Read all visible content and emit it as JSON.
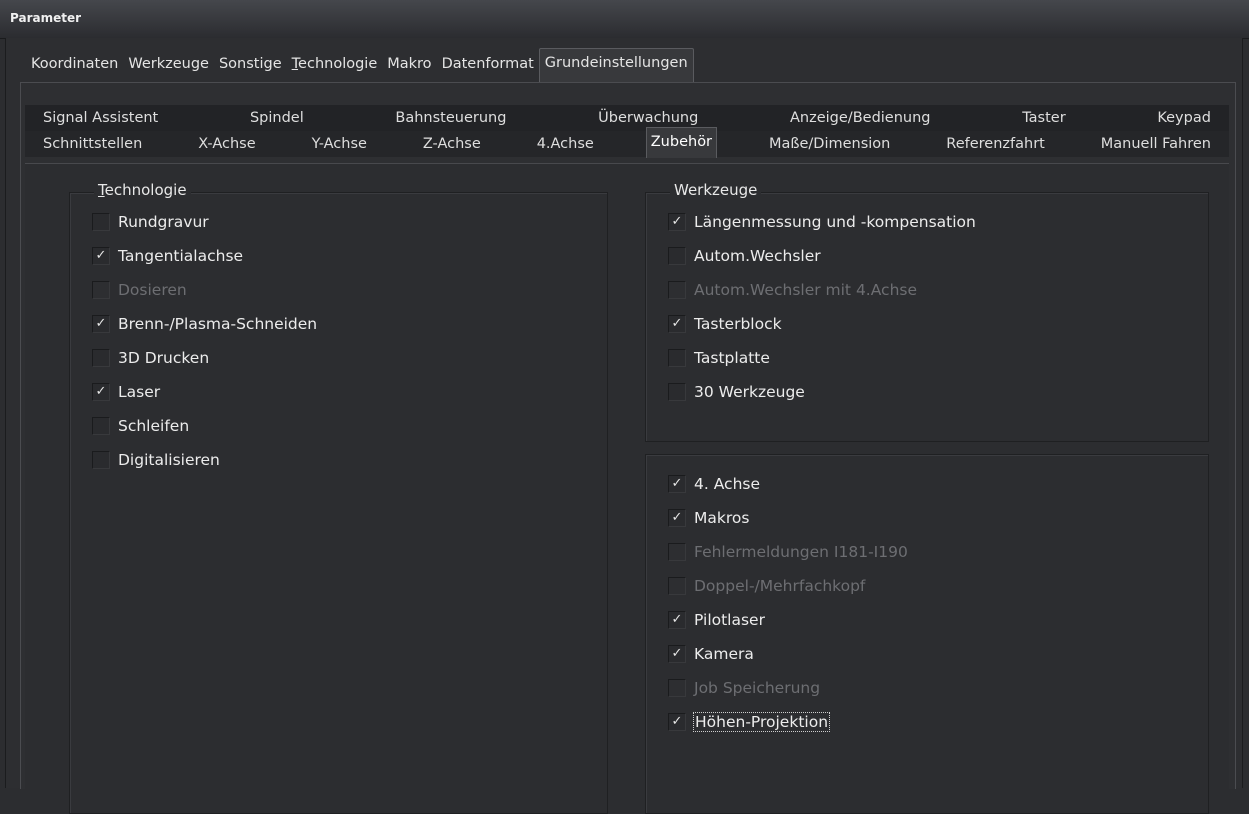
{
  "window": {
    "title": "Parameter"
  },
  "main_tabs": [
    {
      "label": "Koordinaten",
      "active": false
    },
    {
      "label": "Werkzeuge",
      "active": false
    },
    {
      "label": "Sonstige",
      "active": false
    },
    {
      "label": "Technologie",
      "active": false
    },
    {
      "label": "Makro",
      "active": false
    },
    {
      "label": "Datenformat",
      "active": false
    },
    {
      "label": "Grundeinstellungen",
      "active": true
    }
  ],
  "sub_tabs_row1": [
    "Signal Assistent",
    "Spindel",
    "Bahnsteuerung",
    "Überwachung",
    "Anzeige/Bedienung",
    "Taster",
    "Keypad"
  ],
  "sub_tabs_row2": [
    "Schnittstellen",
    "X-Achse",
    "Y-Achse",
    "Z-Achse",
    "4.Achse",
    "Zubehör",
    "Maße/Dimension",
    "Referenzfahrt",
    "Manuell Fahren"
  ],
  "active_sub_tab": "Zubehör",
  "technologie_group": {
    "title": "Technologie",
    "items": [
      {
        "label": "Rundgravur",
        "checked": false,
        "enabled": true
      },
      {
        "label": "Tangentialachse",
        "checked": true,
        "enabled": true
      },
      {
        "label": "Dosieren",
        "checked": false,
        "enabled": false
      },
      {
        "label": "Brenn-/Plasma-Schneiden",
        "checked": true,
        "enabled": true
      },
      {
        "label": "3D Drucken",
        "checked": false,
        "enabled": true
      },
      {
        "label": "Laser",
        "checked": true,
        "enabled": true
      },
      {
        "label": "Schleifen",
        "checked": false,
        "enabled": true
      },
      {
        "label": "Digitalisieren",
        "checked": false,
        "enabled": true
      }
    ]
  },
  "werkzeuge_group": {
    "title": "Werkzeuge",
    "items": [
      {
        "label": "Längenmessung und -kompensation",
        "checked": true,
        "enabled": true
      },
      {
        "label": "Autom.Wechsler",
        "checked": false,
        "enabled": true
      },
      {
        "label": "Autom.Wechsler mit 4.Achse",
        "checked": false,
        "enabled": false
      },
      {
        "label": "Tasterblock",
        "checked": true,
        "enabled": true
      },
      {
        "label": "Tastplatte",
        "checked": false,
        "enabled": true
      },
      {
        "label": "30 Werkzeuge",
        "checked": false,
        "enabled": true
      }
    ]
  },
  "extras_group": {
    "items": [
      {
        "label": "4. Achse",
        "checked": true,
        "enabled": true
      },
      {
        "label": "Makros",
        "checked": true,
        "enabled": true
      },
      {
        "label": "Fehlermeldungen I181-I190",
        "checked": false,
        "enabled": false
      },
      {
        "label": "Doppel-/Mehrfachkopf",
        "checked": false,
        "enabled": false
      },
      {
        "label": "Pilotlaser",
        "checked": true,
        "enabled": true
      },
      {
        "label": "Kamera",
        "checked": true,
        "enabled": true
      },
      {
        "label": "Job Speicherung",
        "checked": false,
        "enabled": false
      },
      {
        "label": "Höhen-Projektion",
        "checked": true,
        "enabled": true,
        "focused": true
      }
    ]
  },
  "check_glyph": "✓"
}
